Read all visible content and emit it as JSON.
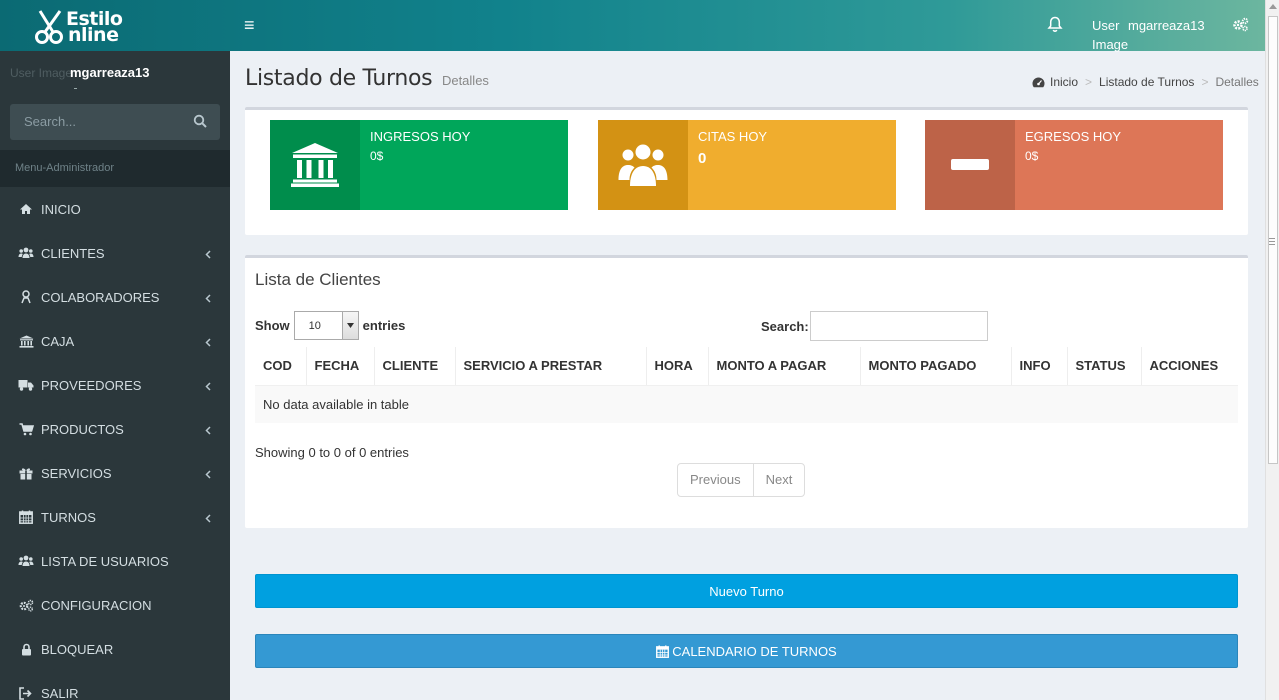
{
  "header": {
    "logo_line1": "Estilo",
    "logo_line2": "nline",
    "menu_toggle": "≡",
    "user_image_alt": "User Image",
    "username": "mgarreaza13"
  },
  "sidebar": {
    "user_image_alt": "User Image",
    "username": "mgarreaza13",
    "search_placeholder": "Search...",
    "menu_header": "Menu-Administrador",
    "items": [
      {
        "label": "INICIO",
        "icon": "home-icon",
        "has_children": false
      },
      {
        "label": "CLIENTES",
        "icon": "users-icon",
        "has_children": true
      },
      {
        "label": "COLABORADORES",
        "icon": "female-icon",
        "has_children": true
      },
      {
        "label": "CAJA",
        "icon": "bank-icon",
        "has_children": true
      },
      {
        "label": "PROVEEDORES",
        "icon": "truck-icon",
        "has_children": true
      },
      {
        "label": "PRODUCTOS",
        "icon": "cart-icon",
        "has_children": true
      },
      {
        "label": "SERVICIOS",
        "icon": "gift-icon",
        "has_children": true
      },
      {
        "label": "TURNOS",
        "icon": "calendar-icon",
        "has_children": true
      },
      {
        "label": "LISTA DE USUARIOS",
        "icon": "users-icon",
        "has_children": false
      },
      {
        "label": "CONFIGURACION",
        "icon": "cogs-icon",
        "has_children": false
      },
      {
        "label": "BLOQUEAR",
        "icon": "lock-icon",
        "has_children": false
      },
      {
        "label": "SALIR",
        "icon": "signout-icon",
        "has_children": false
      }
    ]
  },
  "page": {
    "title": "Listado de Turnos",
    "subtitle": "Detalles",
    "breadcrumb": [
      "Inicio",
      "Listado de Turnos",
      "Detalles"
    ]
  },
  "info_boxes": [
    {
      "label": "INGRESOS HOY",
      "value": "0$",
      "icon": "bank-icon",
      "color": "#00a65a"
    },
    {
      "label": "CITAS HOY",
      "value": "0",
      "icon": "users-icon",
      "color": "#f0ad2e"
    },
    {
      "label": "EGRESOS HOY",
      "value": "0$",
      "icon": "minus-icon",
      "color": "#dd7657"
    }
  ],
  "clients_box": {
    "title": "Lista de Clientes",
    "show_label": "Show",
    "entries_value": "10",
    "entries_label": "entries",
    "search_label": "Search:",
    "search_value": "",
    "columns": [
      "COD",
      "FECHA",
      "CLIENTE",
      "SERVICIO A PRESTAR",
      "HORA",
      "MONTO A PAGAR",
      "MONTO PAGADO",
      "INFO",
      "STATUS",
      "ACCIONES"
    ],
    "empty_message": "No data available in table",
    "showing_text": "Showing 0 to 0 of 0 entries",
    "prev_label": "Previous",
    "next_label": "Next"
  },
  "actions": {
    "new_turn": "Nuevo Turno",
    "calendar": "CALENDARIO DE TURNOS"
  }
}
